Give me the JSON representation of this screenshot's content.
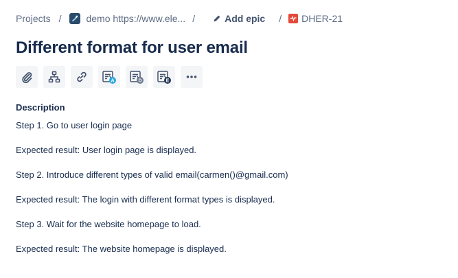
{
  "breadcrumb": {
    "projects_label": "Projects",
    "separator": "/",
    "project_label": "demo https://www.ele...",
    "add_epic_label": "Add epic",
    "issue_key": "DHER-21"
  },
  "issue": {
    "title": "Different format for user email"
  },
  "toolbar": {
    "buttons": [
      {
        "icon": "attachment-icon"
      },
      {
        "icon": "child-issues-icon"
      },
      {
        "icon": "link-issue-icon"
      },
      {
        "icon": "app-a-icon",
        "badge": "A"
      },
      {
        "icon": "app-d-icon",
        "badge": "D"
      },
      {
        "icon": "app-e-icon",
        "badge": "E"
      },
      {
        "icon": "more-icon"
      }
    ]
  },
  "description": {
    "label": "Description",
    "lines": [
      "Step 1. Go to user login page",
      "Expected result: User login page is displayed.",
      "Step 2. Introduce different types of valid email(carmen()@gmail.com)",
      "Expected result: The login with different format types is displayed.",
      "Step 3. Wait for the website homepage to load.",
      "Expected result: The website homepage is displayed."
    ]
  },
  "colors": {
    "text_primary": "#172B4D",
    "text_subtle": "#5E6C84",
    "button_bg": "#F4F5F7",
    "bug_red": "#E5493A",
    "badge_a": "#2AA8E0",
    "badge_d": "#6B778C",
    "badge_e": "#253858"
  }
}
